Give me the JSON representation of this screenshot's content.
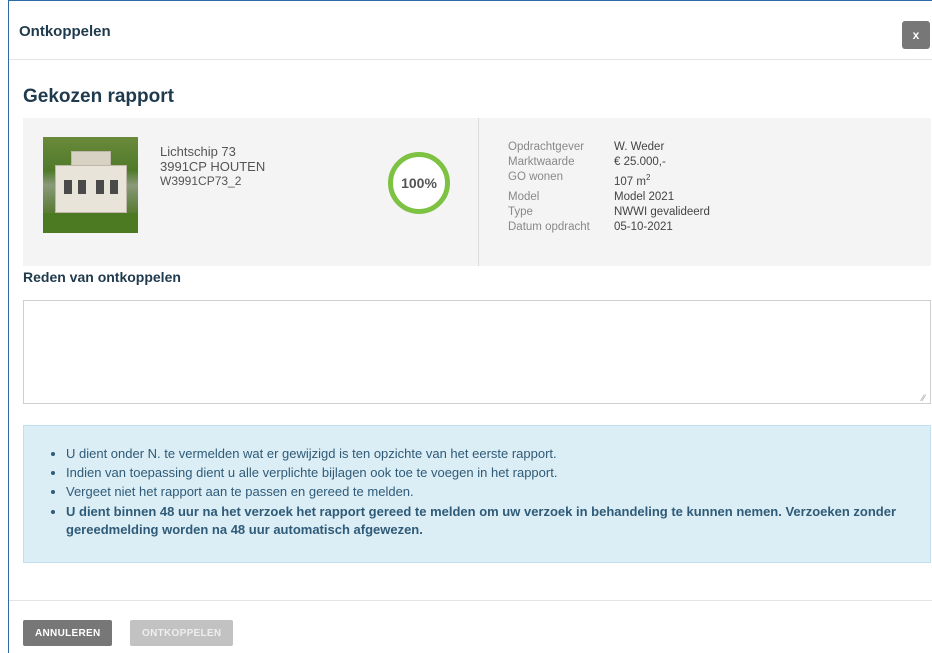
{
  "modal": {
    "title": "Ontkoppelen",
    "close_label": "x"
  },
  "report": {
    "section_title": "Gekozen rapport",
    "address_line1": "Lichtschip 73",
    "address_line2": "3991CP HOUTEN",
    "reference": "W3991CP73_2",
    "progress": "100%",
    "details": [
      {
        "key": "Opdrachtgever",
        "value": "W. Weder"
      },
      {
        "key": "Marktwaarde",
        "value": "€ 25.000,-"
      },
      {
        "key": "GO wonen",
        "value": "107 m",
        "sup": "2"
      },
      {
        "key": "Model",
        "value": "Model 2021"
      },
      {
        "key": "Type",
        "value": "NWWI gevalideerd"
      },
      {
        "key": "Datum opdracht",
        "value": "05-10-2021"
      }
    ]
  },
  "reason": {
    "label": "Reden van ontkoppelen",
    "value": "",
    "placeholder": ""
  },
  "info": {
    "items": [
      "U dient onder N. te vermelden wat er gewijzigd is ten opzichte van het eerste rapport.",
      "Indien van toepassing dient u alle verplichte bijlagen ook toe te voegen in het rapport.",
      "Vergeet niet het rapport aan te passen en gereed te melden."
    ],
    "bold_item": "U dient binnen 48 uur na het verzoek het rapport gereed te melden om uw verzoek in behandeling te kunnen nemen. Verzoeken zonder gereedmelding worden na 48 uur automatisch afgewezen."
  },
  "footer": {
    "cancel_label": "ANNULEREN",
    "disconnect_label": "ONTKOPPELEN"
  },
  "colors": {
    "accent_border": "#2f6aa8",
    "progress_ring": "#7dc243",
    "info_background": "#dbedf5"
  }
}
